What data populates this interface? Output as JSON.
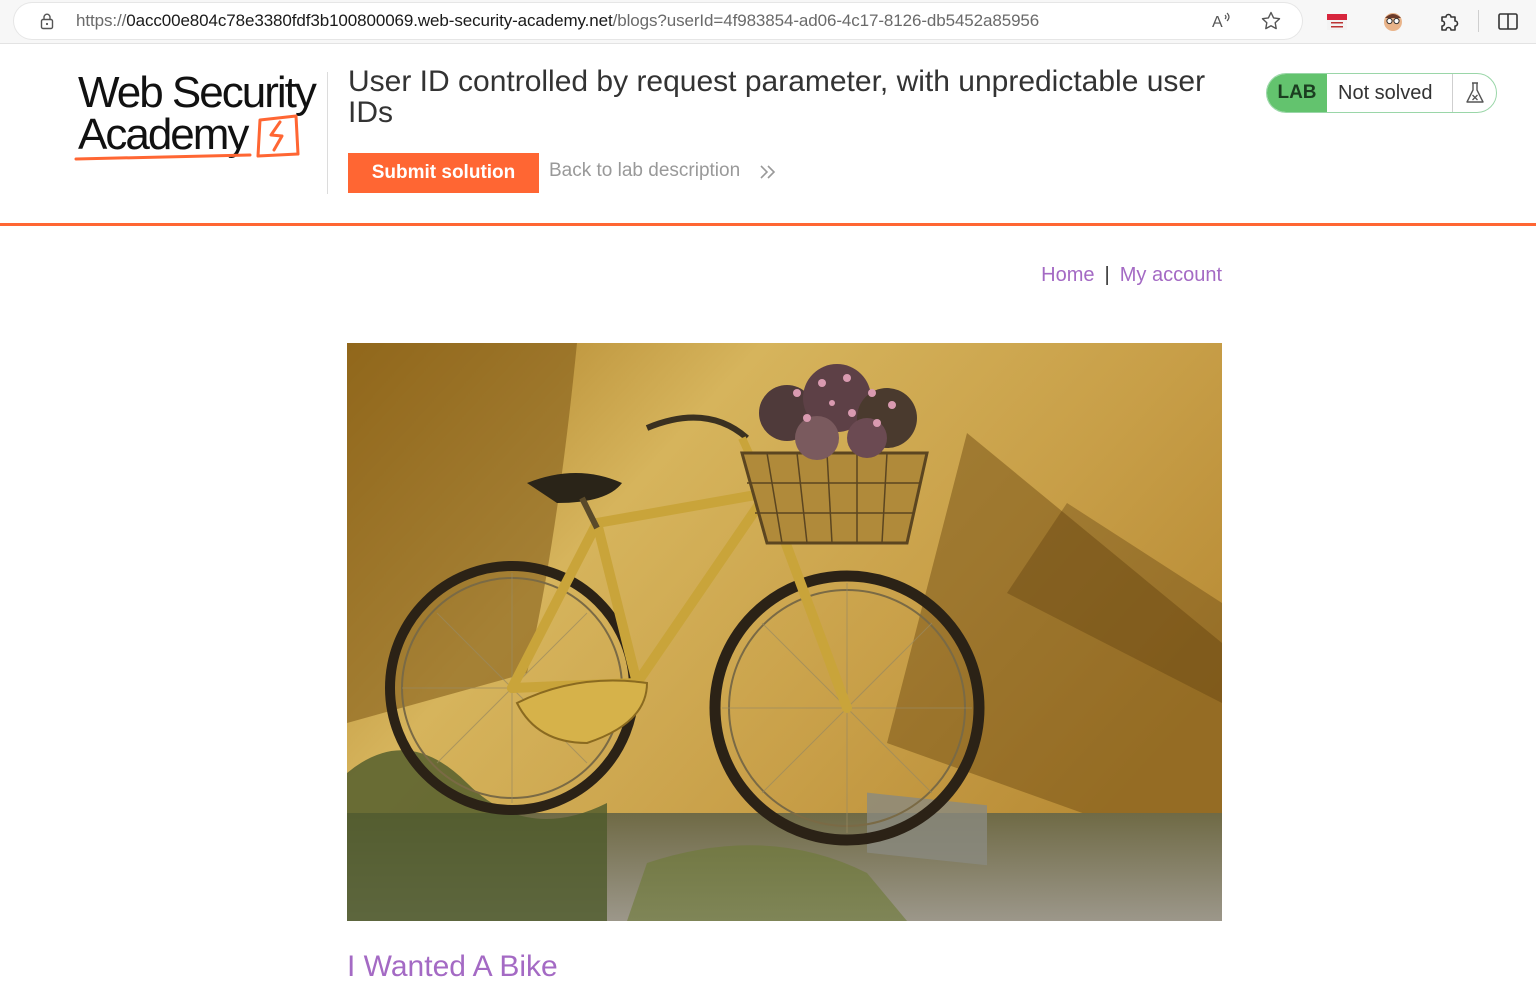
{
  "browser": {
    "url_scheme": "https://",
    "url_host": "0acc00e804c78e3380fdf3b100800069.web-security-academy.net",
    "url_path": "/blogs?userId=4f983854-ad06-4c17-8126-db5452a85956",
    "icons": [
      "lock-icon",
      "read-aloud-icon",
      "favorite-star-icon",
      "flag-extension-icon",
      "avatar-extension-icon",
      "extensions-puzzle-icon",
      "split-screen-icon"
    ]
  },
  "header": {
    "logo_line1": "Web Security",
    "logo_line2": "Academy",
    "lab_title": "User ID controlled by request parameter, with unpredictable user IDs",
    "submit_label": "Submit solution",
    "back_label": "Back to lab description",
    "lab_badge": "LAB",
    "lab_status": "Not solved"
  },
  "nav": {
    "home": "Home",
    "separator": "|",
    "account": "My account"
  },
  "post": {
    "image_alt": "Vintage yellow bicycle with a flower basket leaning against an ochre wall",
    "title": "I Wanted A Bike"
  },
  "colors": {
    "accent_orange": "#ff6633",
    "link_purple": "#a46ac4",
    "lab_green": "#63c36e"
  }
}
